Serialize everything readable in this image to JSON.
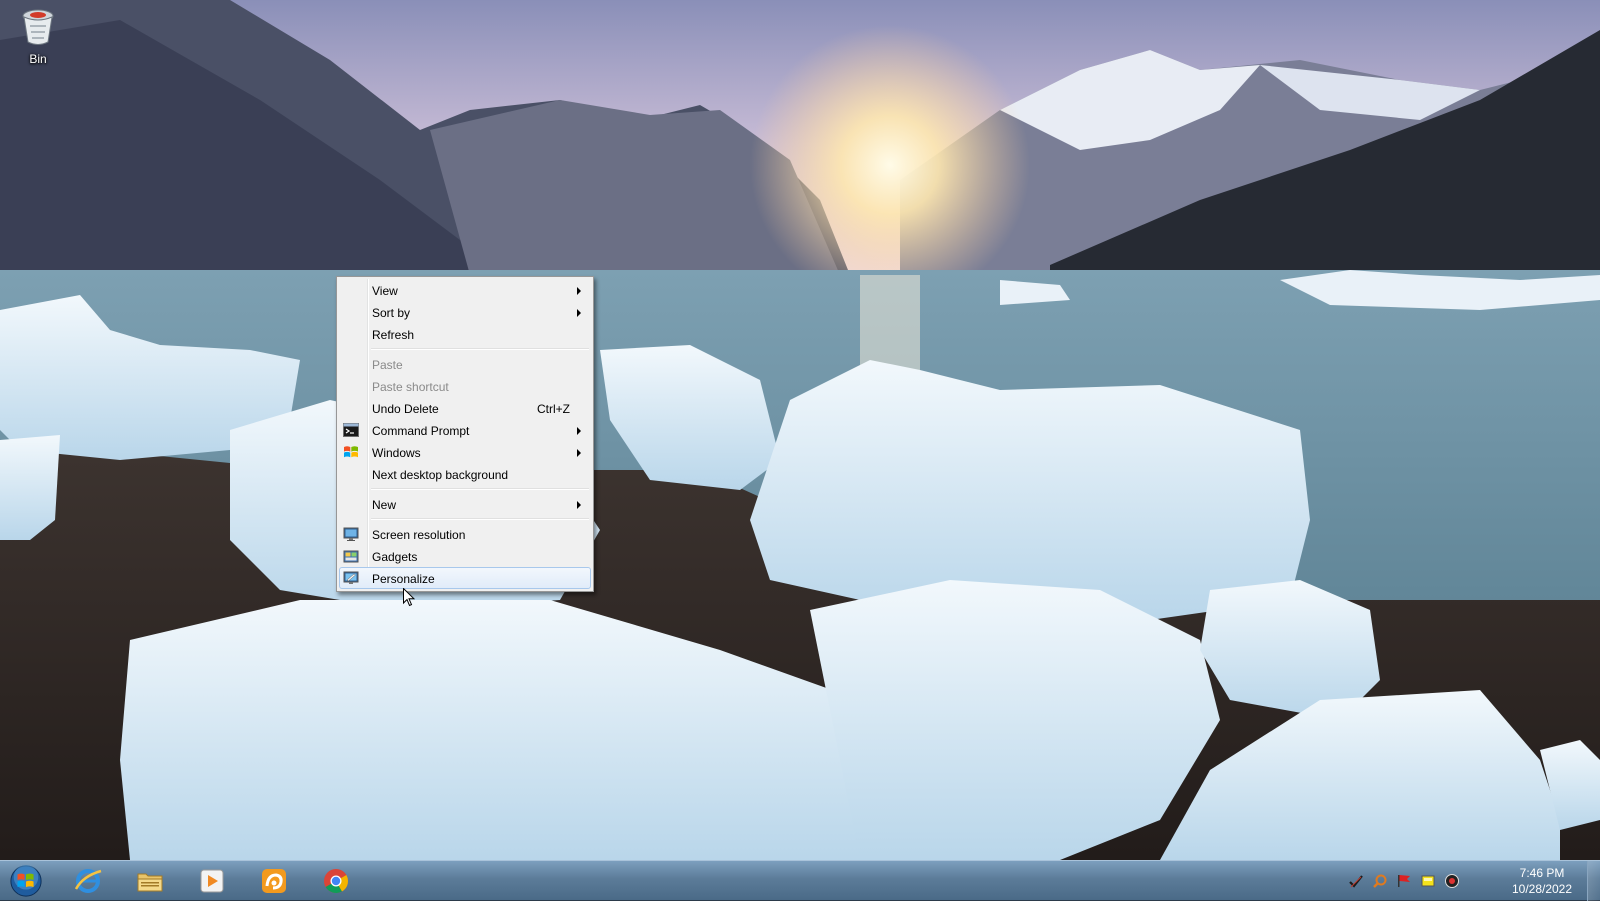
{
  "desktop": {
    "icons": [
      {
        "label": "Bin",
        "icon": "recycle-bin-icon"
      }
    ]
  },
  "context_menu": {
    "items": {
      "view": {
        "label": "View",
        "has_submenu": true
      },
      "sort_by": {
        "label": "Sort by",
        "has_submenu": true
      },
      "refresh": {
        "label": "Refresh"
      },
      "paste": {
        "label": "Paste",
        "enabled": false
      },
      "paste_shortcut": {
        "label": "Paste shortcut",
        "enabled": false
      },
      "undo_delete": {
        "label": "Undo Delete",
        "shortcut": "Ctrl+Z"
      },
      "command_prompt": {
        "label": "Command Prompt",
        "has_submenu": true,
        "icon": "command-prompt-icon"
      },
      "windows": {
        "label": "Windows",
        "has_submenu": true,
        "icon": "windows-logo-icon"
      },
      "next_background": {
        "label": "Next desktop background"
      },
      "new": {
        "label": "New",
        "has_submenu": true
      },
      "screen_resolution": {
        "label": "Screen resolution",
        "icon": "monitor-icon"
      },
      "gadgets": {
        "label": "Gadgets",
        "icon": "gadgets-icon"
      },
      "personalize": {
        "label": "Personalize",
        "icon": "personalize-icon",
        "highlighted": true
      }
    }
  },
  "taskbar": {
    "start_button": {
      "icon": "windows-start-orb-icon"
    },
    "pinned_apps": [
      {
        "icon": "internet-explorer-icon"
      },
      {
        "icon": "file-explorer-icon"
      },
      {
        "icon": "media-player-icon"
      },
      {
        "icon": "uc-browser-icon"
      },
      {
        "icon": "chrome-icon"
      }
    ],
    "tray_icons": [
      "checkmark-icon",
      "search-tool-icon",
      "flag-icon",
      "yellow-box-icon",
      "circle-app-icon"
    ],
    "clock": {
      "time": "7:46 PM",
      "date": "10/28/2022"
    }
  },
  "colors": {
    "menu_background": "#f0f0f0",
    "menu_highlight": "#e1ecf9",
    "menu_highlight_border": "#a8c8ec",
    "disabled_text": "#8a8a8a",
    "taskbar": "#5c7c99"
  }
}
